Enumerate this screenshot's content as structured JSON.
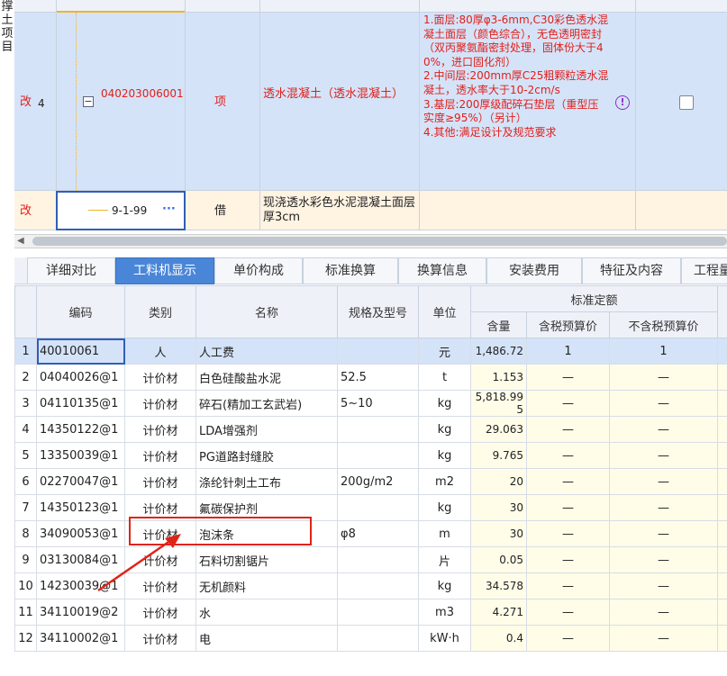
{
  "left_vertical_text": "撑 土 项 目",
  "top_grid": {
    "row4": {
      "flag": "改",
      "index": "4",
      "code": "040203006001",
      "type": "项",
      "name": "透水混凝土（透水混凝土）",
      "description": "1.面层:80厚φ3-6mm,C30彩色透水混凝土面层（颜色综合），无色透明密封（双丙聚氨酯密封处理，固体份大于40%，进口固化剂）\n2.中间层:200mm厚C25粗颗粒透水混凝土，透水率大于10-2cm/s\n3.基层:200厚级配碎石垫层（重型压实度≥95%）（另计）\n4.其他:满足设计及规范要求"
    },
    "row5": {
      "flag": "改",
      "code": "9-1-99",
      "type": "借",
      "name": "现浇透水彩色水泥混凝土面层 厚3cm"
    }
  },
  "tabs": [
    "详细对比",
    "工料机显示",
    "单价构成",
    "标准换算",
    "换算信息",
    "安装费用",
    "特征及内容",
    "工程量"
  ],
  "active_tab": "工料机显示",
  "table": {
    "headers": {
      "code": "编码",
      "category": "类别",
      "name": "名称",
      "spec": "规格及型号",
      "unit": "单位",
      "group": "标准定额",
      "qty": "含量",
      "tax_price": "含税预算价",
      "notax_price": "不含税预算价"
    },
    "rows": [
      {
        "no": "1",
        "code": "40010061",
        "category": "人",
        "name": "人工费",
        "spec": "",
        "unit": "元",
        "qty": "1,486.72",
        "tax": "1",
        "notax": "1"
      },
      {
        "no": "2",
        "code": "04040026@1",
        "category": "计价材",
        "name": "白色硅酸盐水泥",
        "spec": "52.5",
        "unit": "t",
        "qty": "1.153",
        "tax": "—",
        "notax": "—"
      },
      {
        "no": "3",
        "code": "04110135@1",
        "category": "计价材",
        "name": "碎石(精加工玄武岩)",
        "spec": "5~10",
        "unit": "kg",
        "qty": "5,818.995",
        "tax": "—",
        "notax": "—"
      },
      {
        "no": "4",
        "code": "14350122@1",
        "category": "计价材",
        "name": "LDA增强剂",
        "spec": "",
        "unit": "kg",
        "qty": "29.063",
        "tax": "—",
        "notax": "—"
      },
      {
        "no": "5",
        "code": "13350039@1",
        "category": "计价材",
        "name": "PG道路封缝胶",
        "spec": "",
        "unit": "kg",
        "qty": "9.765",
        "tax": "—",
        "notax": "—"
      },
      {
        "no": "6",
        "code": "02270047@1",
        "category": "计价材",
        "name": "涤纶针刺土工布",
        "spec": "200g/m2",
        "unit": "m2",
        "qty": "20",
        "tax": "—",
        "notax": "—"
      },
      {
        "no": "7",
        "code": "14350123@1",
        "category": "计价材",
        "name": "氟碳保护剂",
        "spec": "",
        "unit": "kg",
        "qty": "30",
        "tax": "—",
        "notax": "—"
      },
      {
        "no": "8",
        "code": "34090053@1",
        "category": "计价材",
        "name": "泡沫条",
        "spec": "φ8",
        "unit": "m",
        "qty": "30",
        "tax": "—",
        "notax": "—"
      },
      {
        "no": "9",
        "code": "03130084@1",
        "category": "计价材",
        "name": "石料切割锯片",
        "spec": "",
        "unit": "片",
        "qty": "0.05",
        "tax": "—",
        "notax": "—"
      },
      {
        "no": "10",
        "code": "14230039@1",
        "category": "计价材",
        "name": "无机颜料",
        "spec": "",
        "unit": "kg",
        "qty": "34.578",
        "tax": "—",
        "notax": "—"
      },
      {
        "no": "11",
        "code": "34110019@2",
        "category": "计价材",
        "name": "水",
        "spec": "",
        "unit": "m3",
        "qty": "4.271",
        "tax": "—",
        "notax": "—"
      },
      {
        "no": "12",
        "code": "34110002@1",
        "category": "计价材",
        "name": "电",
        "spec": "",
        "unit": "kW·h",
        "qty": "0.4",
        "tax": "—",
        "notax": "—"
      }
    ]
  },
  "colors": {
    "accent": "#4a86d8",
    "annotation": "#e02418",
    "change_flag": "#e0201b"
  }
}
